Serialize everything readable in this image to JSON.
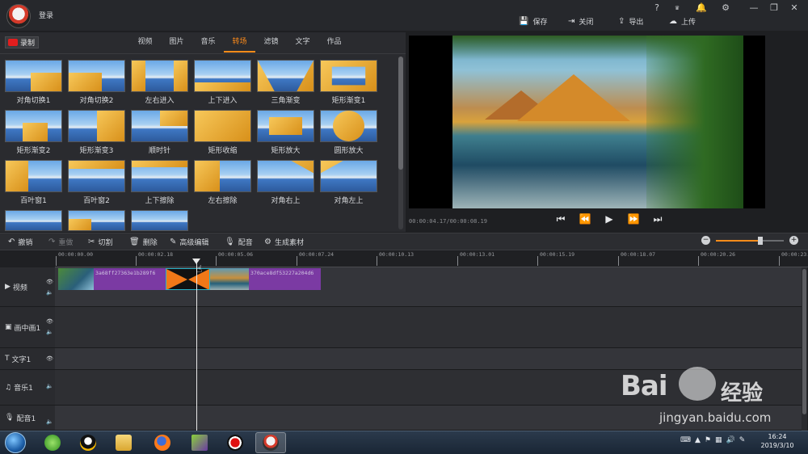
{
  "app": {
    "login_label": "登录",
    "top_icons": [
      "?",
      "VIP",
      "bell",
      "gear",
      "minimize",
      "restore",
      "close"
    ],
    "top_buttons": [
      {
        "icon": "save-icon",
        "label": "保存"
      },
      {
        "icon": "close-file-icon",
        "label": "关闭"
      },
      {
        "icon": "export-icon",
        "label": "导出"
      },
      {
        "icon": "upload-icon",
        "label": "上传"
      }
    ]
  },
  "library": {
    "record_label": "录制",
    "tabs": [
      "视频",
      "图片",
      "音乐",
      "转场",
      "滤镜",
      "文字",
      "作品"
    ],
    "active_tab": "转场",
    "transitions": [
      "对角切换1",
      "对角切换2",
      "左右进入",
      "上下进入",
      "三角渐变",
      "矩形渐变1",
      "矩形渐变2",
      "矩形渐变3",
      "顺时针",
      "矩形收缩",
      "矩形放大",
      "圆形放大",
      "百叶窗1",
      "百叶窗2",
      "上下擦除",
      "左右擦除",
      "对角右上",
      "对角左上",
      "",
      "",
      ""
    ]
  },
  "preview": {
    "timecode": "00:00:04.17/00:00:08.19",
    "controls": [
      "skip-start",
      "step-back",
      "play",
      "step-forward",
      "skip-end"
    ]
  },
  "toolbar": {
    "items": [
      {
        "icon": "undo-icon",
        "label": "撤销",
        "enabled": true
      },
      {
        "icon": "redo-icon",
        "label": "重做",
        "enabled": false
      },
      {
        "icon": "scissors-icon",
        "label": "切割",
        "enabled": true
      },
      {
        "icon": "trash-icon",
        "label": "删除",
        "enabled": true
      },
      {
        "icon": "pencil-icon",
        "label": "高级编辑",
        "enabled": true
      },
      {
        "icon": "microphone-icon",
        "label": "配音",
        "enabled": true
      },
      {
        "icon": "film-reel-icon",
        "label": "生成素材",
        "enabled": true
      }
    ],
    "zoom_level": 0.65
  },
  "timeline": {
    "ruler": [
      "00:00:00.00",
      "00:00:02.18",
      "00:00:05.06",
      "00:00:07.24",
      "00:00:10.13",
      "00:00:13.01",
      "00:00:15.19",
      "00:00:18.07",
      "00:00:20.26",
      "00:00:23.1"
    ],
    "tracks": [
      {
        "name": "视频",
        "icon": "play-icon"
      },
      {
        "name": "画中画1",
        "icon": "pip-icon"
      },
      {
        "name": "文字1",
        "icon": "text-icon"
      },
      {
        "name": "音乐1",
        "icon": "music-icon"
      },
      {
        "name": "配音1",
        "icon": "microphone-icon"
      }
    ],
    "clips": [
      {
        "label": "3a68ff27363e1b289f6"
      },
      {
        "label": "370ace8df53227a204d6"
      }
    ]
  },
  "watermark": {
    "logo": "Bai",
    "cn": "经验",
    "url": "jingyan.baidu.com"
  },
  "taskbar": {
    "time": "16:24",
    "date": "2019/3/10"
  }
}
